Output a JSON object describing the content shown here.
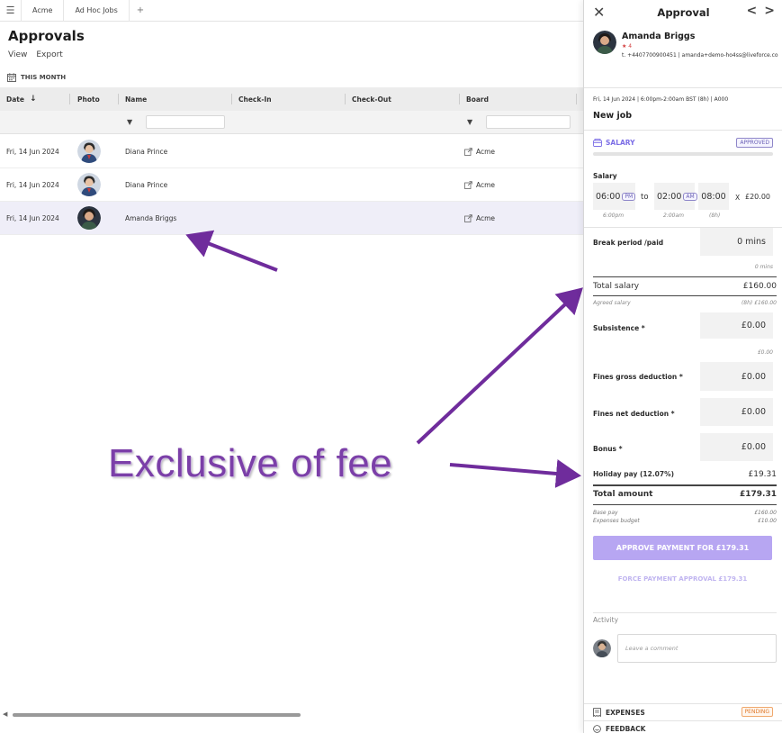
{
  "topbar": {
    "menu_icon": "menu-icon",
    "tabs": [
      {
        "label": "Acme"
      },
      {
        "label": "Ad Hoc Jobs"
      }
    ],
    "add_tab": "+"
  },
  "page": {
    "title": "Approvals",
    "menu": [
      {
        "label": "View"
      },
      {
        "label": "Export"
      }
    ],
    "filter_chip": "THIS MONTH"
  },
  "grid": {
    "columns": [
      {
        "label": "Date"
      },
      {
        "label": "Photo"
      },
      {
        "label": "Name"
      },
      {
        "label": "Check-In"
      },
      {
        "label": "Check-Out"
      },
      {
        "label": "Board"
      }
    ],
    "rows": [
      {
        "date": "Fri, 14 Jun 2024",
        "name": "Diana Prince",
        "board": "Acme",
        "selected": false
      },
      {
        "date": "Fri, 14 Jun 2024",
        "name": "Diana Prince",
        "board": "Acme",
        "selected": false
      },
      {
        "date": "Fri, 14 Jun 2024",
        "name": "Amanda Briggs",
        "board": "Acme",
        "selected": true
      }
    ]
  },
  "annotation": {
    "label": "Exclusive of fee",
    "color": "#6f2c9c"
  },
  "panel": {
    "title": "Approval",
    "prev": "<",
    "next": ">",
    "user": {
      "name": "Amanda Briggs",
      "rating": "★ 4",
      "contact": "t. +4407700900451 | amanda+demo-ho4ss@liveforce.co"
    },
    "job_meta": "Fri, 14 Jun 2024 | 6:00pm-2:00am BST (8h) | A000",
    "job_title": "New job",
    "salary_section": {
      "label": "SALARY",
      "status": "APPROVED"
    },
    "salary": {
      "label": "Salary",
      "start": "06:00",
      "start_ampm": "PM",
      "start_hint": "6:00pm",
      "to": "to",
      "end": "02:00",
      "end_ampm": "AM",
      "end_hint": "2:00am",
      "hours": "08:00",
      "hours_hint": "(8h)",
      "multiplier": "X",
      "rate": "£20.00"
    },
    "break": {
      "label": "Break period /paid",
      "value": "0 mins",
      "hint": "0 mins"
    },
    "total_salary": {
      "label": "Total salary",
      "value": "£160.00",
      "hint_label": "Agreed salary",
      "hint_value": "(8h) £160.00"
    },
    "subsistence": {
      "label": "Subsistence *",
      "value": "£0.00",
      "hint": "£0.00"
    },
    "fines_gross": {
      "label": "Fines gross deduction *",
      "value": "£0.00"
    },
    "fines_net": {
      "label": "Fines net deduction *",
      "value": "£0.00"
    },
    "bonus": {
      "label": "Bonus *",
      "value": "£0.00"
    },
    "holiday": {
      "label": "Holiday pay (12.07%)",
      "value": "£19.31"
    },
    "total_amount": {
      "label": "Total amount",
      "value": "£179.31"
    },
    "base_pay": {
      "label": "Base pay",
      "value": "£160.00"
    },
    "expenses_budget": {
      "label": "Expenses budget",
      "value": "£10.00"
    },
    "approve_button": "APPROVE PAYMENT FOR £179.31",
    "force_button": "FORCE PAYMENT APPROVAL £179.31",
    "activity_label": "Activity",
    "comment_placeholder": "Leave a comment",
    "expenses": {
      "label": "EXPENSES",
      "status": "PENDING"
    },
    "feedback": {
      "label": "FEEDBACK"
    }
  },
  "colors": {
    "accent": "#7c6ee6",
    "approve_button": "#b7a6f2",
    "annotation": "#6f2c9c",
    "selected_row": "#efeef8"
  }
}
